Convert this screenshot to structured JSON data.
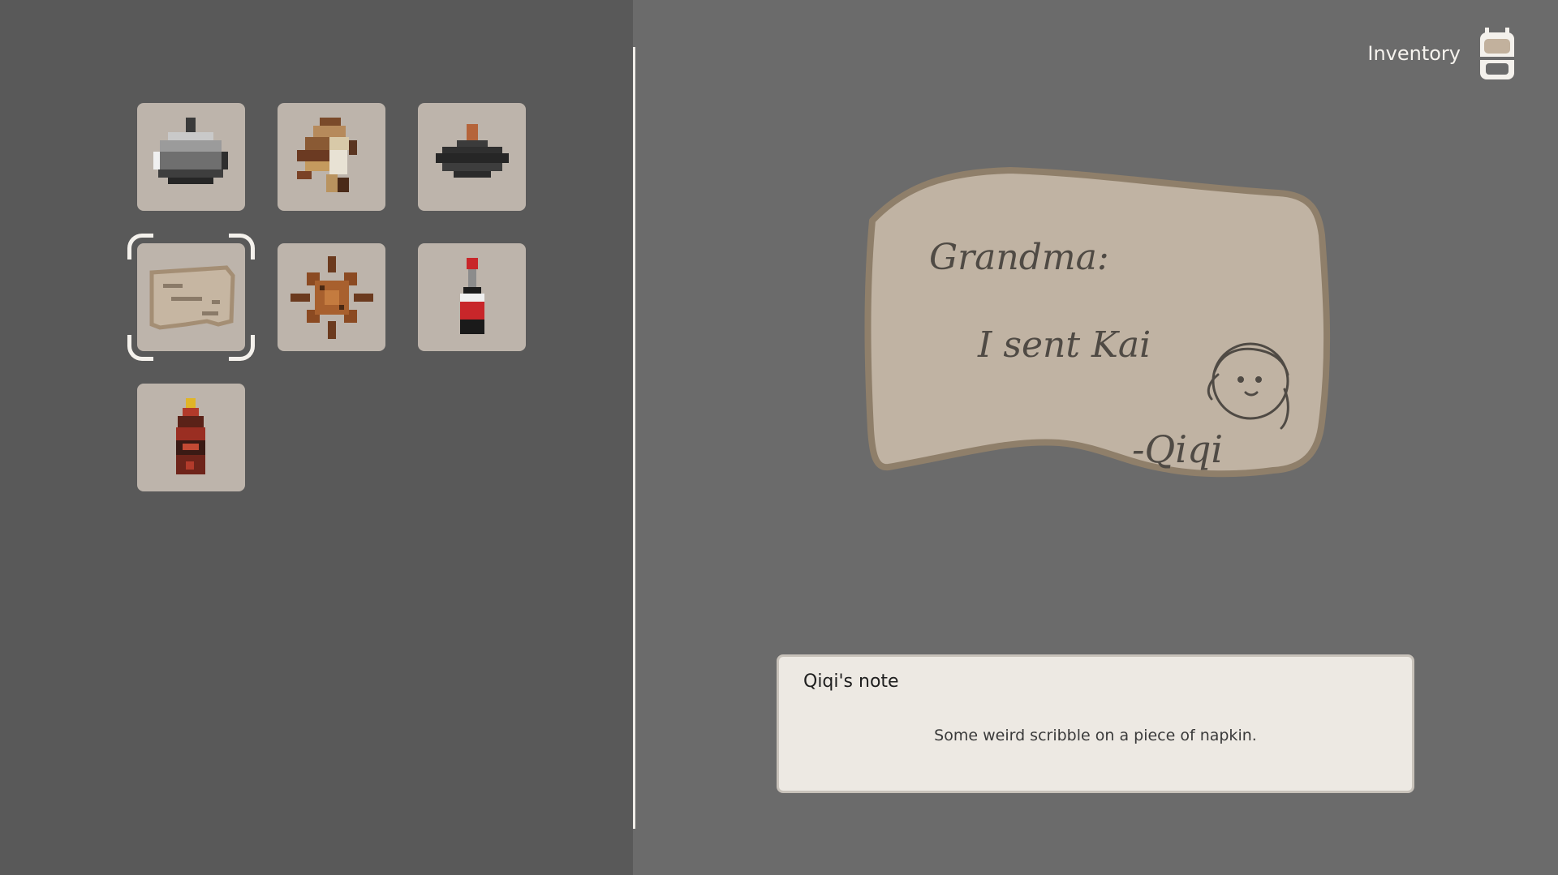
{
  "header": {
    "inventory_label": "Inventory",
    "inventory_icon": "backpack-icon"
  },
  "inventory": {
    "items": [
      {
        "icon": "pot-icon",
        "selected": false
      },
      {
        "icon": "bread-basket-icon",
        "selected": false
      },
      {
        "icon": "wok-icon",
        "selected": false
      },
      {
        "icon": "napkin-note-icon",
        "selected": true
      },
      {
        "icon": "star-anise-icon",
        "selected": false
      },
      {
        "icon": "sauce-bottle-icon",
        "selected": false
      },
      {
        "icon": "spice-bottle-icon",
        "selected": false
      }
    ]
  },
  "preview": {
    "note_lines": [
      "Grandma:",
      "I sent Kai",
      "-Qiqi"
    ]
  },
  "description": {
    "title": "Qiqi's note",
    "text": "Some weird scribble on a piece of napkin."
  },
  "colors": {
    "left_panel": "#595959",
    "right_panel": "#6b6b6b",
    "slot": "#bdb4ab",
    "napkin_fill": "#c0b3a3",
    "napkin_border": "#8f7f6a"
  }
}
